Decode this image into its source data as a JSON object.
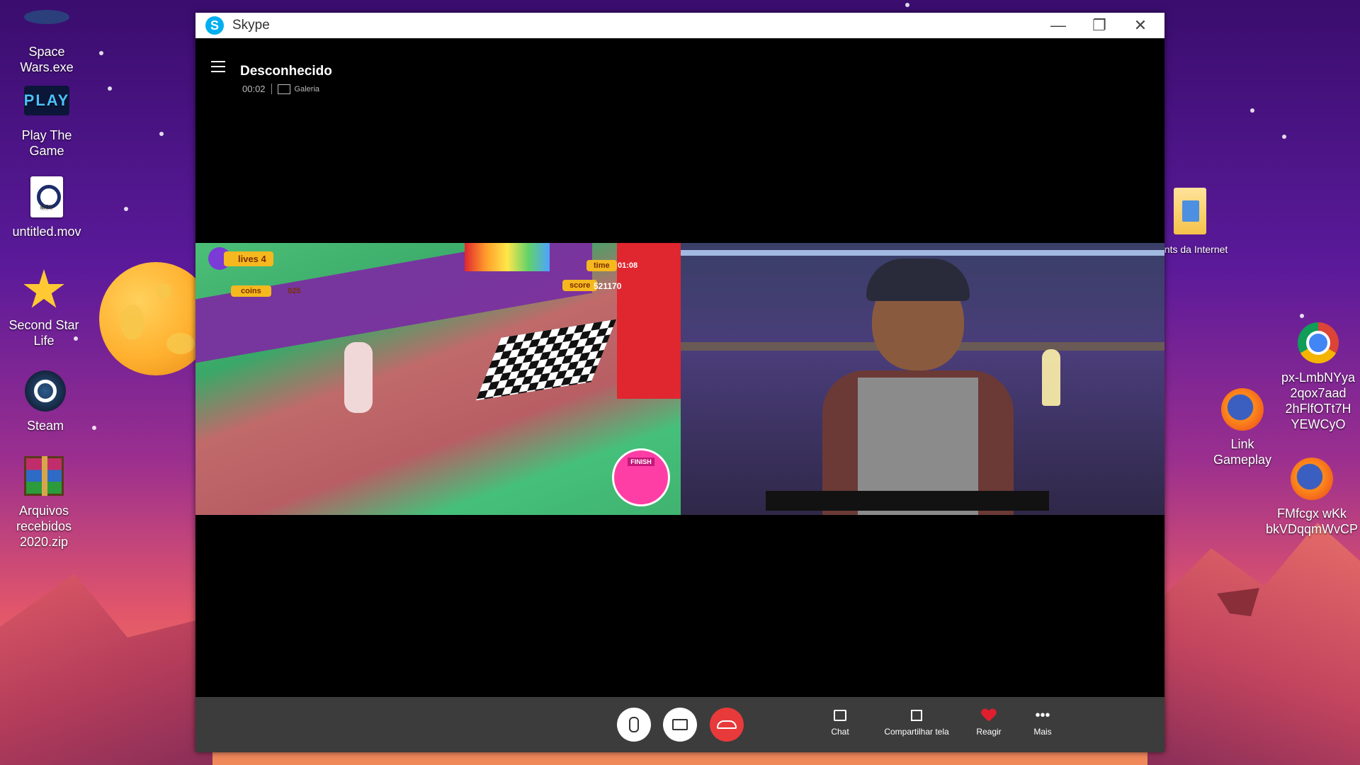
{
  "desktop": {
    "icons_left": [
      {
        "label": "Space Wars.exe",
        "icon": "space-wars-icon"
      },
      {
        "label": "Play The Game",
        "icon": "play-game-icon",
        "logo_text": "PLAY"
      },
      {
        "label": "untitled.mov",
        "icon": "quicktime-movie-icon",
        "badge": "MOV"
      },
      {
        "label": "Second Star Life",
        "icon": "star-icon"
      },
      {
        "label": "Steam",
        "icon": "steam-icon"
      },
      {
        "label": "Arquivos recebidos 2020.zip",
        "icon": "winrar-archive-icon"
      }
    ],
    "icons_right": [
      {
        "label": "Prints da Internet",
        "icon": "folder-icon"
      },
      {
        "label": "px-LmbNYya 2qox7aad 2hFlfOTt7H YEWCyO",
        "icon": "chrome-icon"
      },
      {
        "label": "Link Gameplay",
        "icon": "firefox-icon"
      },
      {
        "label": "FMfcgx wKk bkVDqqmWvCP",
        "icon": "firefox-icon"
      }
    ]
  },
  "window": {
    "title": "Skype",
    "controls": {
      "minimize": "—",
      "maximize": "❐",
      "close": "✕"
    }
  },
  "call": {
    "caller": "Desconhecido",
    "timer": "00:02",
    "view_label": "Galeria",
    "game_hud": {
      "lives_label": "lives",
      "lives_value": "4",
      "coins_label": "coins",
      "coins_value": "025",
      "time_label": "time",
      "time_value": "01:08",
      "score_label": "score",
      "score_value": "521170",
      "finish_label": "FINISH"
    }
  },
  "toolbar": {
    "chat": "Chat",
    "share": "Compartilhar tela",
    "react": "Reagir",
    "more": "Mais",
    "more_glyph": "•••"
  }
}
